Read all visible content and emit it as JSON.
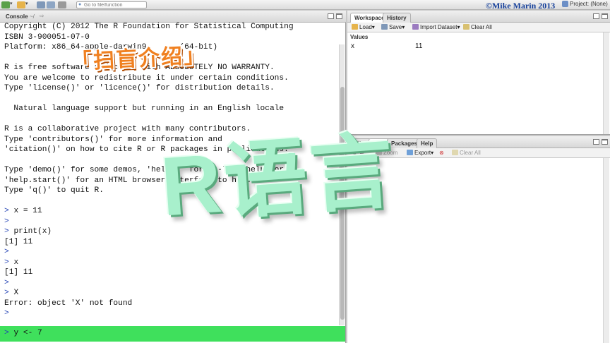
{
  "toolbar": {
    "goto_placeholder": "Go to file/function",
    "copyright": "©Mike Marin 2013",
    "project_label": "Project: (None)"
  },
  "console": {
    "title": "Console",
    "path": "~/",
    "lines": [
      {
        "prompt": "",
        "text": "Copyright (C) 2012 The R Foundation for Statistical Computing"
      },
      {
        "prompt": "",
        "text": "ISBN 3-900051-07-0"
      },
      {
        "prompt": "",
        "text": "Platform: x86_64-apple-darwin9.      (64-bit)"
      },
      {
        "prompt": "",
        "text": ""
      },
      {
        "prompt": "",
        "text": "R is free software and comes with ABSOLUTELY NO WARRANTY."
      },
      {
        "prompt": "",
        "text": "You are welcome to redistribute it under certain conditions."
      },
      {
        "prompt": "",
        "text": "Type 'license()' or 'licence()' for distribution details."
      },
      {
        "prompt": "",
        "text": ""
      },
      {
        "prompt": "",
        "text": "  Natural language support but running in an English locale"
      },
      {
        "prompt": "",
        "text": ""
      },
      {
        "prompt": "",
        "text": "R is a collaborative project with many contributors."
      },
      {
        "prompt": "",
        "text": "Type 'contributors()' for more information and"
      },
      {
        "prompt": "",
        "text": "'citation()' on how to cite R or R packages in publications."
      },
      {
        "prompt": "",
        "text": ""
      },
      {
        "prompt": "",
        "text": "Type 'demo()' for some demos, 'help()' for on-line help, or"
      },
      {
        "prompt": "",
        "text": "'help.start()' for an HTML browser interface to help."
      },
      {
        "prompt": "",
        "text": "Type 'q()' to quit R."
      },
      {
        "prompt": "",
        "text": ""
      },
      {
        "prompt": "> ",
        "text": "x = 11"
      },
      {
        "prompt": "> ",
        "text": ""
      },
      {
        "prompt": "> ",
        "text": "print(x)"
      },
      {
        "prompt": "",
        "text": "[1] 11"
      },
      {
        "prompt": "> ",
        "text": ""
      },
      {
        "prompt": "> ",
        "text": "x"
      },
      {
        "prompt": "",
        "text": "[1] 11"
      },
      {
        "prompt": "> ",
        "text": ""
      },
      {
        "prompt": "> ",
        "text": "X"
      },
      {
        "prompt": "",
        "text": "Error: object 'X' not found"
      },
      {
        "prompt": "> ",
        "text": ""
      }
    ],
    "input_prompt": "> ",
    "input_text": "y <- 7"
  },
  "overlay": {
    "title": "「扫盲介绍」",
    "big_text": "R语言"
  },
  "workspace": {
    "tabs": [
      {
        "label": "Workspace",
        "active": true
      },
      {
        "label": "History",
        "active": false
      }
    ],
    "tools": {
      "load": "Load",
      "save": "Save",
      "import": "Import Dataset",
      "clear": "Clear All"
    },
    "section": "Values",
    "rows": [
      {
        "name": "x",
        "value": "11"
      }
    ]
  },
  "files": {
    "tabs": [
      {
        "label": "Files",
        "active": false
      },
      {
        "label": "Plots",
        "active": true
      },
      {
        "label": "Packages",
        "active": false
      },
      {
        "label": "Help",
        "active": false
      }
    ],
    "tools": {
      "zoom": "Zoom",
      "export": "Export",
      "clear": "Clear All"
    }
  },
  "colors": {
    "input_highlight": "#3fe05c",
    "prompt": "#1f3fb3",
    "overlay_title": "#f08020",
    "overlay_big": "#a8f0cc"
  }
}
